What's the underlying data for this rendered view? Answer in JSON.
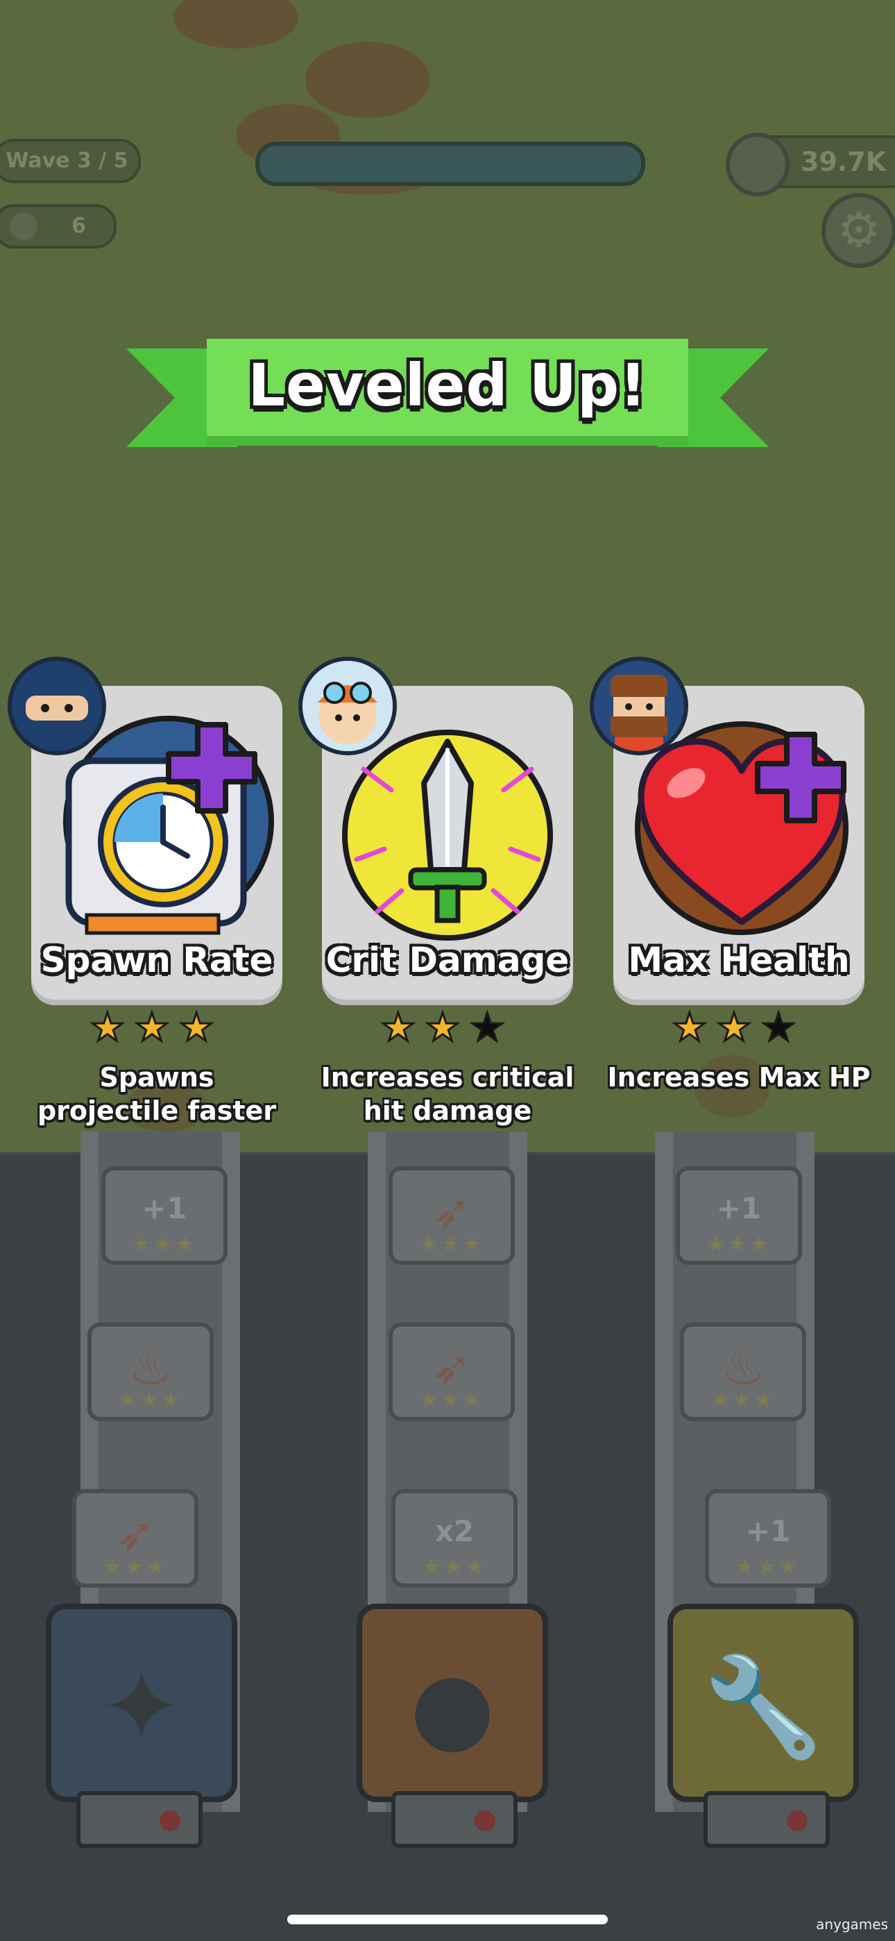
{
  "hud": {
    "wave_label": "Wave 3 / 5",
    "wave_progress": 1.0,
    "kill_count": "6",
    "coins": "39.7K",
    "icons": {
      "kills": "skull-icon",
      "coins": "coin-icon",
      "settings": "gear-icon"
    }
  },
  "banner": {
    "title": "Leveled Up!"
  },
  "cards": [
    {
      "title": "Spawn Rate",
      "stars_filled": 3,
      "stars_total": 3,
      "description": "Spawns projectile faster",
      "icon": "clock-plus-icon",
      "character": "ninja-avatar",
      "circle_color": "#2f5d92"
    },
    {
      "title": "Crit Damage",
      "stars_filled": 2,
      "stars_total": 3,
      "description": "Increases critical hit damage",
      "icon": "sword-icon",
      "character": "aviator-avatar",
      "circle_color": "#f0e63a"
    },
    {
      "title": "Max Health",
      "stars_filled": 2,
      "stars_total": 3,
      "description": "Increases Max HP",
      "icon": "heart-plus-icon",
      "character": "bearded-avatar",
      "circle_color": "#8a4a20"
    }
  ],
  "dock": {
    "slots": [
      "+1",
      "x2",
      "+1"
    ],
    "towers": [
      {
        "icon": "shuriken-icon",
        "color": "#3a4a5a"
      },
      {
        "icon": "bomb-icon",
        "color": "#6a4e34"
      },
      {
        "icon": "wrench-icon",
        "color": "#6e6a38"
      }
    ]
  },
  "watermark": "anygames"
}
